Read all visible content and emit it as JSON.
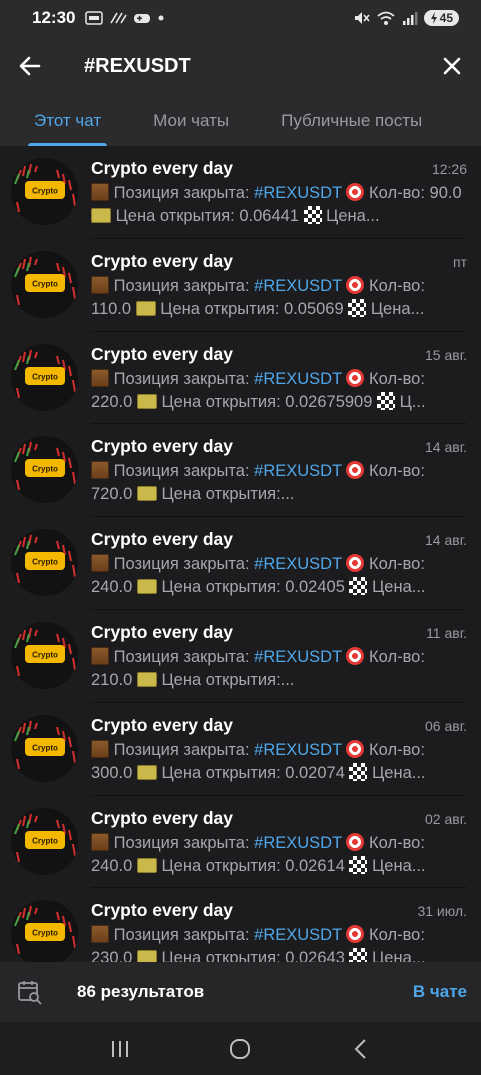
{
  "status_bar": {
    "time": "12:30",
    "battery": "45"
  },
  "header": {
    "title": "#REXUSDT"
  },
  "tabs": [
    {
      "label": "Этот чат",
      "active": true
    },
    {
      "label": "Мои чаты",
      "active": false
    },
    {
      "label": "Публичные посты",
      "active": false
    }
  ],
  "results": [
    {
      "name": "Crypto every day",
      "date": "12:26",
      "prefix": "Позиция закрыта: ",
      "tag": "#REXUSDT",
      "qty_label": " Кол-во: ",
      "qty": "90.0",
      "price_label": " Цена открытия: ",
      "price": "0.06441",
      "tail": " Цена..."
    },
    {
      "name": "Crypto every day",
      "date": "пт",
      "prefix": "Позиция закрыта: ",
      "tag": "#REXUSDT",
      "qty_label": " Кол-во: ",
      "qty": "110.0",
      "price_label": " Цена открытия: ",
      "price": "0.05069",
      "tail": " Цена..."
    },
    {
      "name": "Crypto every day",
      "date": "15 авг.",
      "prefix": "Позиция закрыта: ",
      "tag": "#REXUSDT",
      "qty_label": " Кол-во: ",
      "qty": "220.0",
      "price_label": " Цена открытия: ",
      "price": "0.02675909",
      "tail": " Ц..."
    },
    {
      "name": "Crypto every day",
      "date": "14 авг.",
      "prefix": "Позиция закрыта: ",
      "tag": "#REXUSDT",
      "qty_label": " Кол-во: ",
      "qty": "720.0",
      "price_label": " Цена открытия:...",
      "price": "",
      "tail": ""
    },
    {
      "name": "Crypto every day",
      "date": "14 авг.",
      "prefix": "Позиция закрыта: ",
      "tag": "#REXUSDT",
      "qty_label": " Кол-во: ",
      "qty": "240.0",
      "price_label": " Цена открытия: ",
      "price": "0.02405",
      "tail": " Цена..."
    },
    {
      "name": "Crypto every day",
      "date": "11 авг.",
      "prefix": "Позиция закрыта: ",
      "tag": "#REXUSDT",
      "qty_label": " Кол-во: ",
      "qty": "210.0",
      "price_label": " Цена открытия:...",
      "price": "",
      "tail": ""
    },
    {
      "name": "Crypto every day",
      "date": "06 авг.",
      "prefix": "Позиция закрыта: ",
      "tag": "#REXUSDT",
      "qty_label": " Кол-во: ",
      "qty": "300.0",
      "price_label": " Цена открытия: ",
      "price": "0.02074",
      "tail": " Цена..."
    },
    {
      "name": "Crypto every day",
      "date": "02 авг.",
      "prefix": "Позиция закрыта: ",
      "tag": "#REXUSDT",
      "qty_label": " Кол-во: ",
      "qty": "240.0",
      "price_label": " Цена открытия: ",
      "price": "0.02614",
      "tail": " Цена..."
    },
    {
      "name": "Crypto every day",
      "date": "31 июл.",
      "prefix": "Позиция закрыта: ",
      "tag": "#REXUSDT",
      "qty_label": " Кол-во: ",
      "qty": "230.0",
      "price_label": " Цена открытия: ",
      "price": "0.02643",
      "tail": " Цена..."
    }
  ],
  "avatar_label": "Crypto",
  "footer": {
    "count": "86 результатов",
    "in_chat": "В чате"
  },
  "colors": {
    "accent": "#4fa6e8",
    "background": "#1c1c1e",
    "header": "#2b2b2d"
  }
}
